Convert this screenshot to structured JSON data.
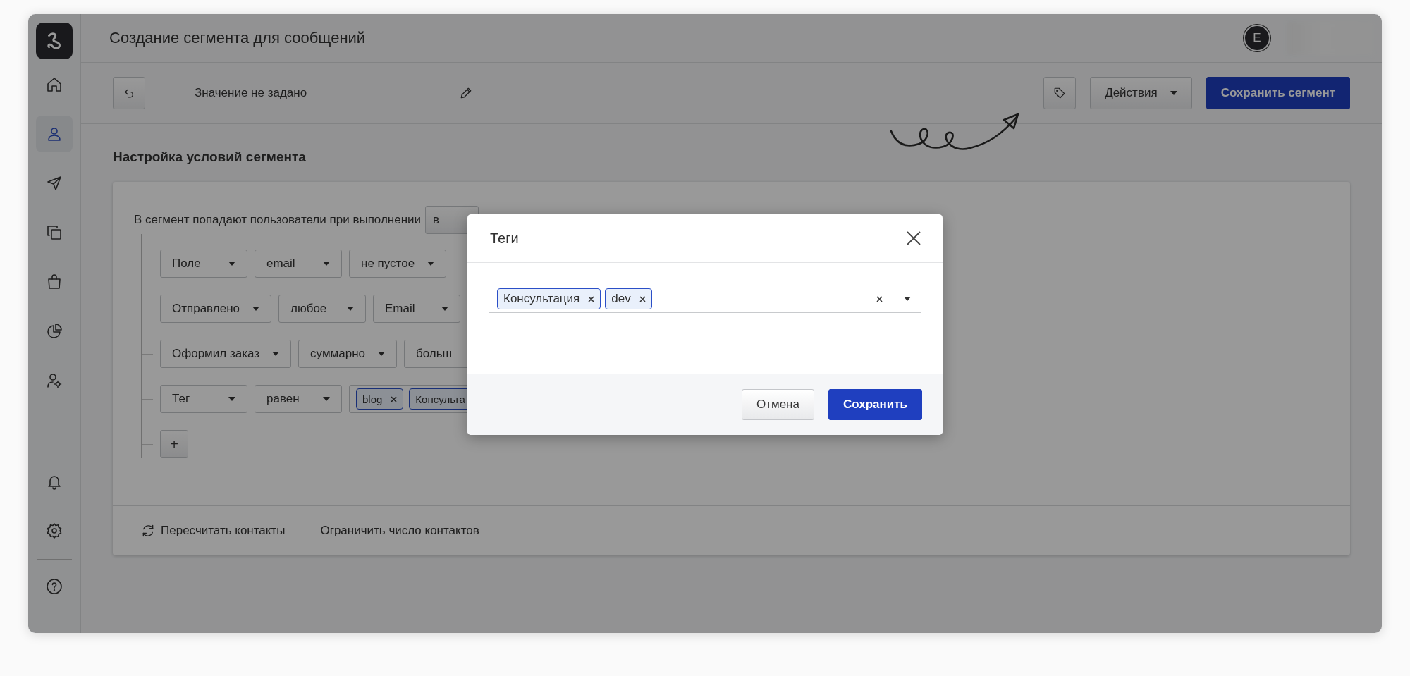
{
  "sidebar": {
    "items": [
      {
        "selected": false
      },
      {
        "selected": true
      },
      {
        "selected": false
      },
      {
        "selected": false
      },
      {
        "selected": false
      },
      {
        "selected": false
      },
      {
        "selected": false
      }
    ],
    "bottom_items": [
      {
        "selected": false
      },
      {
        "selected": false
      },
      {
        "selected": false
      }
    ]
  },
  "header": {
    "title": "Создание сегмента для сообщений",
    "avatar_initial": "E"
  },
  "toolbar": {
    "name_value": "Значение не задано",
    "actions_button": "Действия",
    "save_button": "Сохранить сегмент"
  },
  "section_title": "Настройка условий сегмента",
  "conditions": {
    "intro": "В сегмент попадают пользователи при выполнении",
    "match_button": "в",
    "rows": [
      {
        "selects": [
          "Поле",
          "email",
          "не пустое"
        ],
        "tags": []
      },
      {
        "selects": [
          "Отправлено",
          "любое",
          "Email"
        ],
        "tags": []
      },
      {
        "selects": [
          "Оформил заказ",
          "суммарно",
          "больш"
        ],
        "tags": []
      },
      {
        "selects": [
          "Тег",
          "равен"
        ],
        "tags": [
          "blog",
          "Консульта"
        ]
      }
    ],
    "add_button": "+"
  },
  "footer": {
    "recalc": "Пересчитать контакты",
    "limit": "Ограничить число контактов"
  },
  "dialog": {
    "title": "Теги",
    "tags": [
      "Консультация",
      "dev"
    ],
    "cancel": "Отмена",
    "save": "Сохранить"
  }
}
